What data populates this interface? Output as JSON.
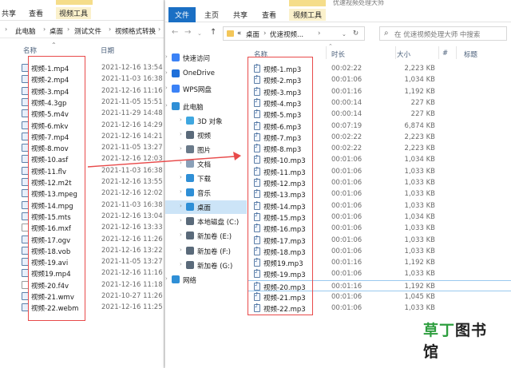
{
  "left_window": {
    "ribbon_tabs": [
      "共享",
      "查看",
      "视频工具"
    ],
    "address": [
      "此电脑",
      "桌面",
      "测试文件",
      "视频格式转换"
    ],
    "columns": {
      "name": "名称",
      "date": "日期"
    },
    "files": [
      {
        "name": "视频-1.mp4",
        "date": "2021-12-16 13:54",
        "blank": false
      },
      {
        "name": "视频-2.mp4",
        "date": "2021-11-03 16:38",
        "blank": false
      },
      {
        "name": "视频-3.mp4",
        "date": "2021-12-16 11:16",
        "blank": false
      },
      {
        "name": "视频-4.3gp",
        "date": "2021-11-05 15:51",
        "blank": false
      },
      {
        "name": "视频-5.m4v",
        "date": "2021-11-29 14:48",
        "blank": false
      },
      {
        "name": "视频-6.mkv",
        "date": "2021-12-16 14:29",
        "blank": false
      },
      {
        "name": "视频-7.mp4",
        "date": "2021-12-16 14:21",
        "blank": false
      },
      {
        "name": "视频-8.mov",
        "date": "2021-11-05 13:27",
        "blank": false
      },
      {
        "name": "视频-10.asf",
        "date": "2021-12-16 12:03",
        "blank": false
      },
      {
        "name": "视频-11.flv",
        "date": "2021-11-03 16:38",
        "blank": false
      },
      {
        "name": "视频-12.m2t",
        "date": "2021-12-16 13:55",
        "blank": false
      },
      {
        "name": "视频-13.mpeg",
        "date": "2021-12-16 12:02",
        "blank": false
      },
      {
        "name": "视频-14.mpg",
        "date": "2021-11-03 16:38",
        "blank": false
      },
      {
        "name": "视频-15.mts",
        "date": "2021-12-16 13:04",
        "blank": false
      },
      {
        "name": "视频-16.mxf",
        "date": "2021-12-16 13:33",
        "blank": true
      },
      {
        "name": "视频-17.ogv",
        "date": "2021-12-16 11:26",
        "blank": false
      },
      {
        "name": "视频-18.vob",
        "date": "2021-12-16 13:22",
        "blank": false
      },
      {
        "name": "视频-19.avi",
        "date": "2021-11-05 13:27",
        "blank": false
      },
      {
        "name": "视频19.mp4",
        "date": "2021-12-16 11:16",
        "blank": false
      },
      {
        "name": "视频-20.f4v",
        "date": "2021-12-16 11:18",
        "blank": true
      },
      {
        "name": "视频-21.wmv",
        "date": "2021-10-27 11:26",
        "blank": false
      },
      {
        "name": "视频-22.webm",
        "date": "2021-12-16 11:25",
        "blank": false
      }
    ]
  },
  "right_window": {
    "title": "优速视频处理大师",
    "ribbon_tabs": [
      "文件",
      "主页",
      "共享",
      "查看",
      "视频工具"
    ],
    "context_tab_header": "播放",
    "address": [
      "«",
      "桌面",
      "优速视频...",
      "›"
    ],
    "search_placeholder": "在 优速视频处理大师 中搜索",
    "nav": [
      {
        "label": "快速访问",
        "icon": "star-icon",
        "color": "#3b82f6",
        "indent": 0,
        "caret": true
      },
      {
        "label": "OneDrive",
        "icon": "cloud-icon",
        "color": "#1e6fd9",
        "indent": 0,
        "caret": true
      },
      {
        "label": "WPS网盘",
        "icon": "cloud-icon",
        "color": "#3b82f6",
        "indent": 0,
        "caret": true
      },
      {
        "label": "此电脑",
        "icon": "computer-icon",
        "color": "#2f8fd6",
        "indent": 0,
        "caret": true
      },
      {
        "label": "3D 对象",
        "icon": "cube-icon",
        "color": "#3fa7e0",
        "indent": 1,
        "caret": true
      },
      {
        "label": "视频",
        "icon": "video-icon",
        "color": "#5a6a7a",
        "indent": 1,
        "caret": true
      },
      {
        "label": "图片",
        "icon": "picture-icon",
        "color": "#6a7a8a",
        "indent": 1,
        "caret": true
      },
      {
        "label": "文档",
        "icon": "document-icon",
        "color": "#8aa0b8",
        "indent": 1,
        "caret": true
      },
      {
        "label": "下载",
        "icon": "download-icon",
        "color": "#2f8fd6",
        "indent": 1,
        "caret": true
      },
      {
        "label": "音乐",
        "icon": "music-icon",
        "color": "#2f8fd6",
        "indent": 1,
        "caret": true
      },
      {
        "label": "桌面",
        "icon": "desktop-icon",
        "color": "#2f8fd6",
        "indent": 1,
        "caret": true,
        "selected": true
      },
      {
        "label": "本地磁盘 (C:)",
        "icon": "drive-icon",
        "color": "#5a6a7a",
        "indent": 1,
        "caret": true
      },
      {
        "label": "新加卷 (E:)",
        "icon": "drive-icon",
        "color": "#5a6a7a",
        "indent": 1,
        "caret": true
      },
      {
        "label": "新加卷 (F:)",
        "icon": "drive-icon",
        "color": "#5a6a7a",
        "indent": 1,
        "caret": true
      },
      {
        "label": "新加卷 (G:)",
        "icon": "drive-icon",
        "color": "#5a6a7a",
        "indent": 1,
        "caret": true
      },
      {
        "label": "网络",
        "icon": "network-icon",
        "color": "#2f8fd6",
        "indent": 0,
        "caret": true
      }
    ],
    "columns": {
      "name": "名称",
      "duration": "时长",
      "size": "大小",
      "rating": "#",
      "tags": "标题"
    },
    "files": [
      {
        "name": "视频-1.mp3",
        "duration": "00:02:22",
        "size": "2,223 KB"
      },
      {
        "name": "视频-2.mp3",
        "duration": "00:01:06",
        "size": "1,034 KB"
      },
      {
        "name": "视频-3.mp3",
        "duration": "00:01:16",
        "size": "1,192 KB"
      },
      {
        "name": "视频-4.mp3",
        "duration": "00:00:14",
        "size": "227 KB"
      },
      {
        "name": "视频-5.mp3",
        "duration": "00:00:14",
        "size": "227 KB"
      },
      {
        "name": "视频-6.mp3",
        "duration": "00:07:19",
        "size": "6,874 KB"
      },
      {
        "name": "视频-7.mp3",
        "duration": "00:02:22",
        "size": "2,223 KB"
      },
      {
        "name": "视频-8.mp3",
        "duration": "00:02:22",
        "size": "2,223 KB"
      },
      {
        "name": "视频-10.mp3",
        "duration": "00:01:06",
        "size": "1,034 KB"
      },
      {
        "name": "视频-11.mp3",
        "duration": "00:01:06",
        "size": "1,033 KB"
      },
      {
        "name": "视频-12.mp3",
        "duration": "00:01:06",
        "size": "1,033 KB"
      },
      {
        "name": "视频-13.mp3",
        "duration": "00:01:06",
        "size": "1,033 KB"
      },
      {
        "name": "视频-14.mp3",
        "duration": "00:01:06",
        "size": "1,033 KB"
      },
      {
        "name": "视频-15.mp3",
        "duration": "00:01:06",
        "size": "1,034 KB"
      },
      {
        "name": "视频-16.mp3",
        "duration": "00:01:06",
        "size": "1,033 KB"
      },
      {
        "name": "视频-17.mp3",
        "duration": "00:01:06",
        "size": "1,033 KB"
      },
      {
        "name": "视频-18.mp3",
        "duration": "00:01:06",
        "size": "1,033 KB"
      },
      {
        "name": "视频19.mp3",
        "duration": "00:01:16",
        "size": "1,192 KB"
      },
      {
        "name": "视频-19.mp3",
        "duration": "00:01:06",
        "size": "1,033 KB"
      },
      {
        "name": "视频-20.mp3",
        "duration": "00:01:16",
        "size": "1,192 KB",
        "selected": true
      },
      {
        "name": "视频-21.mp3",
        "duration": "00:01:06",
        "size": "1,045 KB"
      },
      {
        "name": "视频-22.mp3",
        "duration": "00:01:06",
        "size": "1,033 KB"
      }
    ]
  },
  "watermark": {
    "part1": "草丁",
    "part2": "图书馆"
  },
  "colors": {
    "highlight_box": "#e84a4a",
    "arrow": "#e84a4a",
    "file_tab": "#1a6fc4",
    "context_tab": "#f5dd8a",
    "nav_selected": "#cce4f7"
  }
}
